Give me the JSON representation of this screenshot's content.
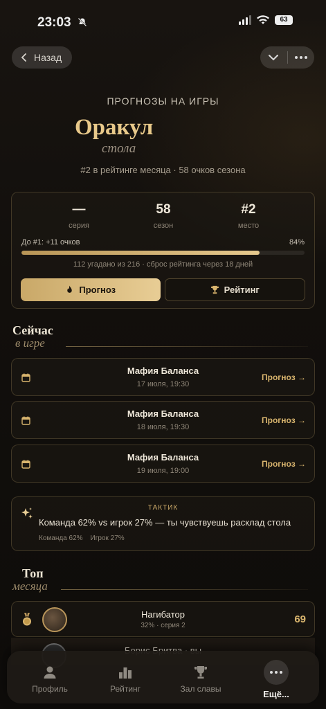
{
  "status": {
    "time": "23:03",
    "battery": "63"
  },
  "topbar": {
    "back_label": "Назад"
  },
  "header": {
    "kicker": "ПРОГНОЗЫ НА ИГРЫ",
    "title": "Оракул",
    "subtitle": "стола",
    "meta": "#2 в рейтинге месяца · 58 очков сезона"
  },
  "stats": {
    "items": [
      {
        "value": "—",
        "label": "серия"
      },
      {
        "value": "58",
        "label": "сезон"
      },
      {
        "value": "#2",
        "label": "место"
      }
    ],
    "progress_label": "До #1: +11 очков",
    "progress_percent_text": "84%",
    "progress_fraction": 0.84,
    "progress_note": "112 угадано из 216 · сброс рейтинга через 18 дней",
    "btn_forecast": "Прогноз",
    "btn_rating": "Рейтинг"
  },
  "now": {
    "heading": "Сейчас",
    "sub": "в игре",
    "games": [
      {
        "name": "Мафия Баланса",
        "date": "17 июля, 19:30",
        "cta": "Прогноз →"
      },
      {
        "name": "Мафия Баланса",
        "date": "18 июля, 19:30",
        "cta": "Прогноз →"
      },
      {
        "name": "Мафия Баланса",
        "date": "19 июля, 19:00",
        "cta": "Прогноз →"
      }
    ]
  },
  "tactic": {
    "label": "ТАКТИК",
    "message": "Команда 62% vs игрок 27% — ты чувствуешь расклад стола",
    "team": "Команда 62%",
    "player": "Игрок 27%"
  },
  "top": {
    "heading": "Топ",
    "sub": "месяца",
    "rows": [
      {
        "name": "Нагибатор",
        "sub": "32% · серия 2",
        "score": "69"
      },
      {
        "name": "Борис Бритва · вы"
      }
    ]
  },
  "nav": {
    "items": [
      {
        "label": "Профиль",
        "icon": "person-icon"
      },
      {
        "label": "Рейтинг",
        "icon": "bar-chart-icon"
      },
      {
        "label": "Зал славы",
        "icon": "trophy-icon"
      },
      {
        "label": "Ещё...",
        "icon": "more-icon"
      }
    ]
  },
  "colors": {
    "accent": "#d9b56e",
    "background": "#120f0c"
  }
}
